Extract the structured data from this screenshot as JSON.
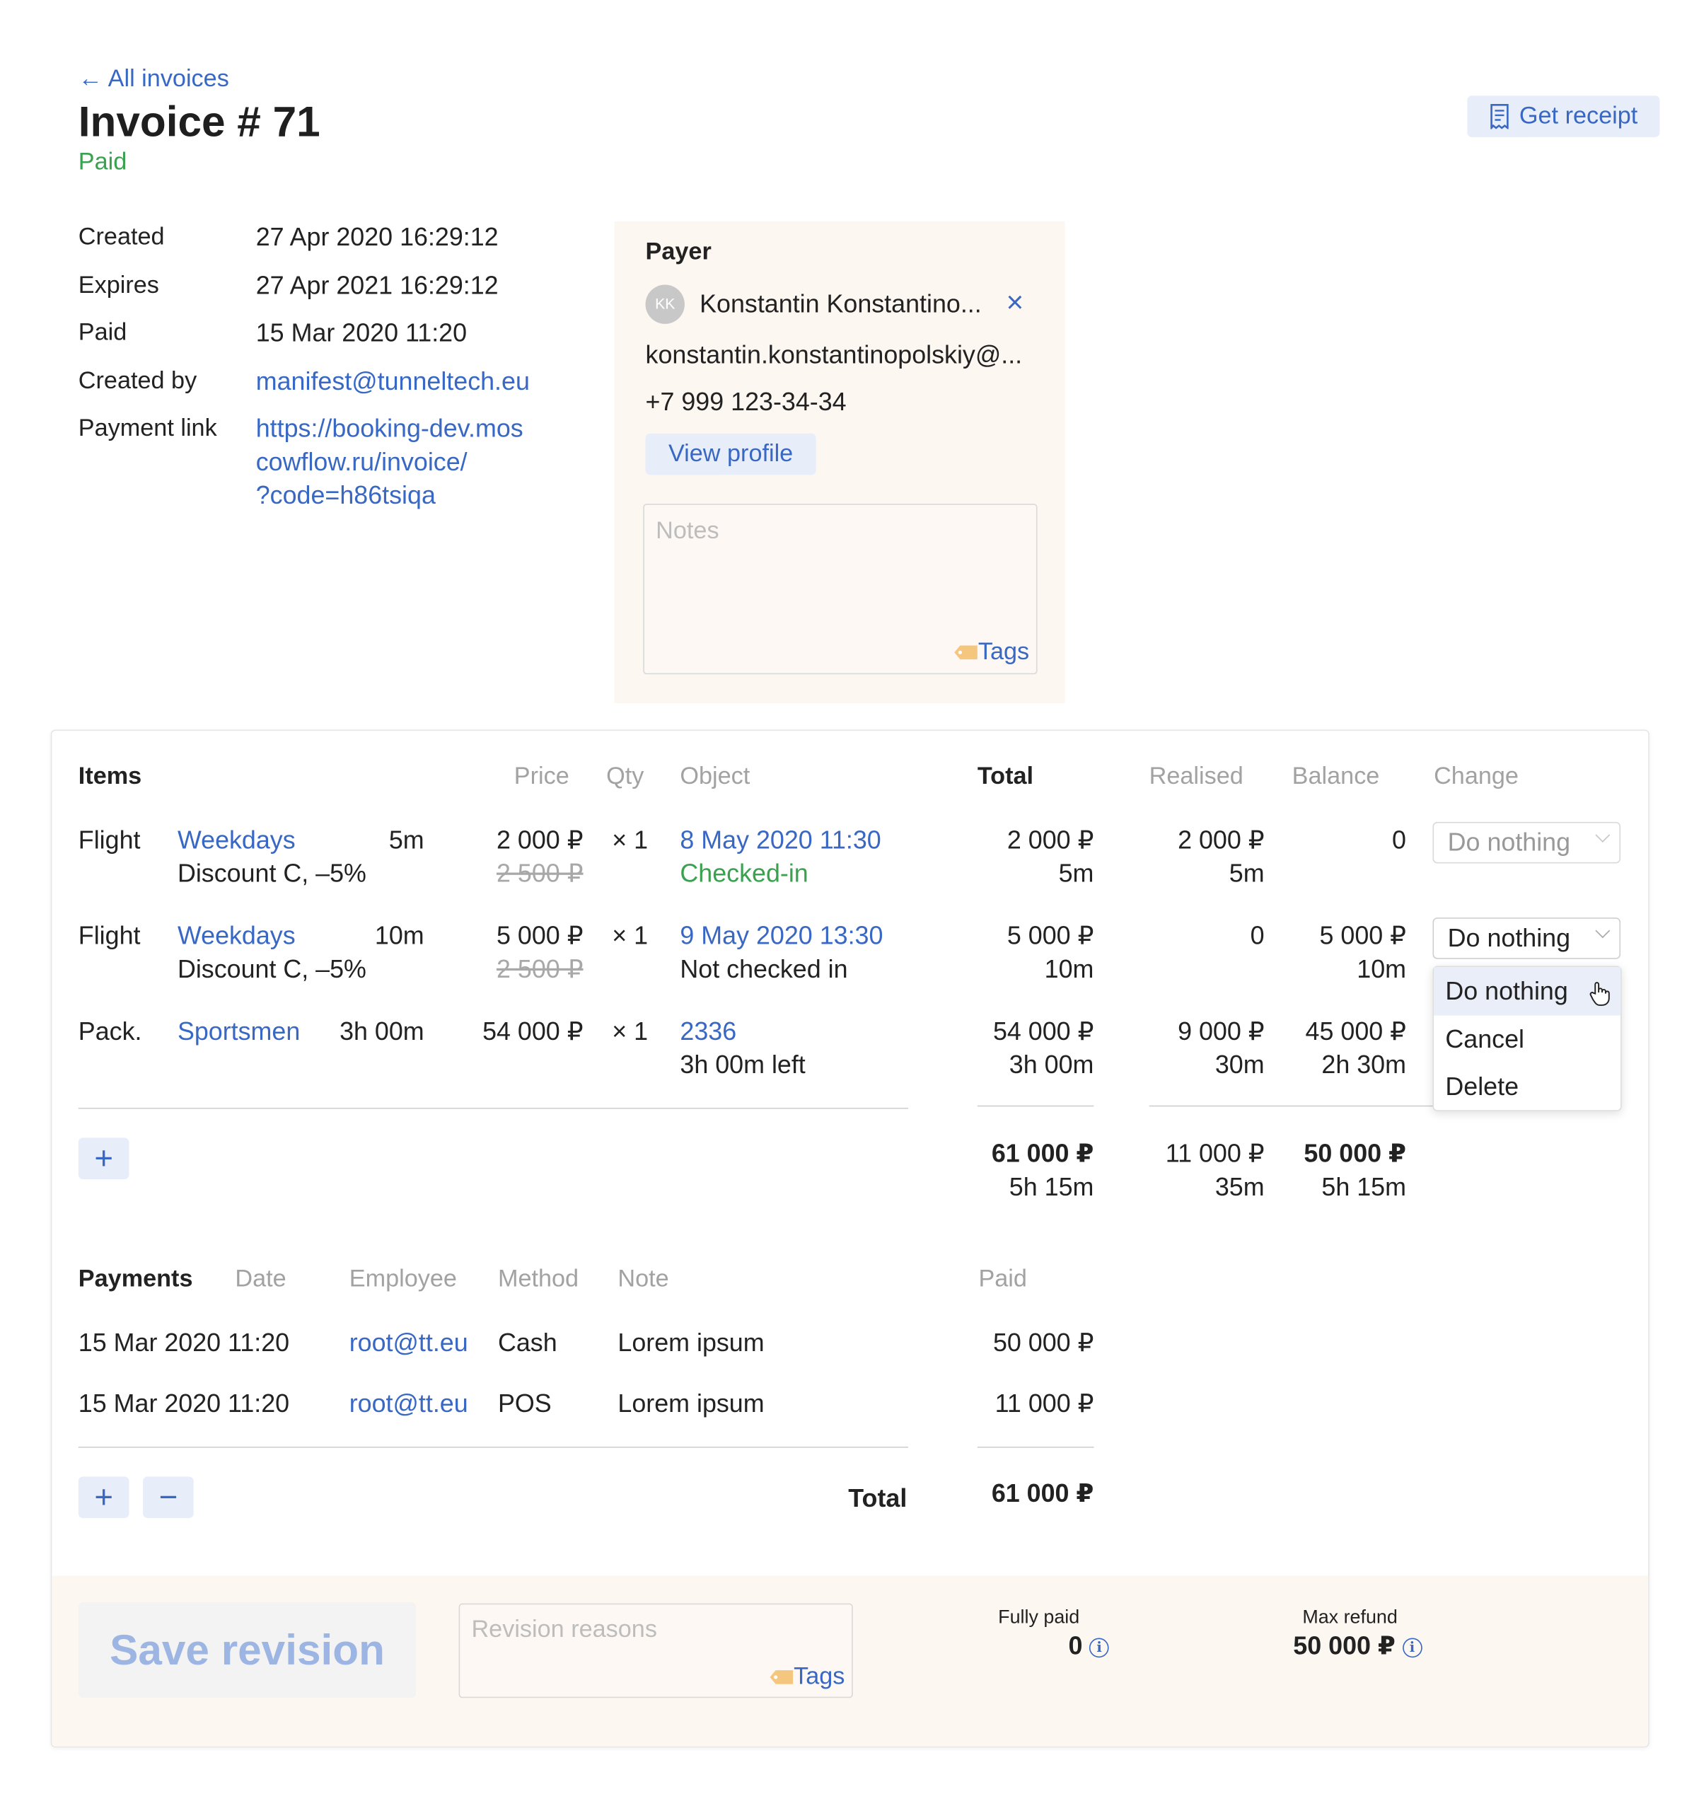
{
  "header": {
    "back_link": "← All invoices",
    "title": "Invoice # 71",
    "status": "Paid",
    "receipt_button": "Get receipt"
  },
  "details": {
    "created_label": "Created",
    "created_value": "27 Apr 2020 16:29:12",
    "expires_label": "Expires",
    "expires_value": "27 Apr 2021 16:29:12",
    "paid_label": "Paid",
    "paid_value": "15 Mar 2020 11:20",
    "created_by_label": "Created by",
    "created_by_value": "manifest@tunneltech.eu",
    "payment_link_label": "Payment link",
    "payment_link_lines": [
      "https://booking-dev.mos",
      "cowflow.ru/invoice/",
      "?code=h86tsiqa"
    ]
  },
  "payer": {
    "heading": "Payer",
    "initials": "KK",
    "name": "Konstantin Konstantino...",
    "remove": "×",
    "email": "konstantin.konstantinopolskiy@...",
    "phone": "+7 999 123-34-34",
    "view_profile": "View profile",
    "notes_placeholder": "Notes",
    "tags": "Tags"
  },
  "items": {
    "headers": {
      "items": "Items",
      "price": "Price",
      "qty": "Qty",
      "object": "Object",
      "total": "Total",
      "realised": "Realised",
      "balance": "Balance",
      "change": "Change"
    },
    "rows": [
      {
        "type": "Flight",
        "name": "Weekdays",
        "duration": "5m",
        "discount": "Discount C, –5%",
        "price": "2 000 ₽",
        "old_price": "2 500 ₽",
        "qty": "× 1",
        "object": "8 May 2020 11:30",
        "object_sub": "Checked-in",
        "total": "2 000 ₽",
        "total_sub": "5m",
        "realised": "2 000 ₽",
        "realised_sub": "5m",
        "balance": "0",
        "balance_sub": "",
        "change": "Do nothing"
      },
      {
        "type": "Flight",
        "name": "Weekdays",
        "duration": "10m",
        "discount": "Discount C, –5%",
        "price": "5 000 ₽",
        "old_price": "2 500 ₽",
        "qty": "× 1",
        "object": "9 May 2020 13:30",
        "object_sub": "Not checked in",
        "total": "5 000 ₽",
        "total_sub": "10m",
        "realised": "0",
        "realised_sub": "",
        "balance": "5 000 ₽",
        "balance_sub": "10m",
        "change": "Do nothing"
      },
      {
        "type": "Pack.",
        "name": "Sportsmen",
        "duration": "3h 00m",
        "discount": "",
        "price": "54 000 ₽",
        "old_price": "",
        "qty": "× 1",
        "object": "2336",
        "object_sub": "3h 00m left",
        "total": "54 000 ₽",
        "total_sub": "3h 00m",
        "realised": "9 000 ₽",
        "realised_sub": "30m",
        "balance": "45 000 ₽",
        "balance_sub": "2h 30m",
        "change": ""
      }
    ],
    "totals": {
      "total": "61 000 ₽",
      "total_sub": "5h 15m",
      "realised": "11 000 ₽",
      "realised_sub": "35m",
      "balance": "50 000 ₽",
      "balance_sub": "5h 15m"
    },
    "add": "+",
    "dropdown_options": [
      "Do nothing",
      "Cancel",
      "Delete"
    ]
  },
  "payments": {
    "headers": {
      "payments": "Payments",
      "date": "Date",
      "employee": "Employee",
      "method": "Method",
      "note": "Note",
      "paid": "Paid"
    },
    "rows": [
      {
        "date": "15 Mar 2020 11:20",
        "employee": "root@tt.eu",
        "method": "Cash",
        "note": "Lorem ipsum",
        "paid": "50 000 ₽"
      },
      {
        "date": "15 Mar 2020 11:20",
        "employee": "root@tt.eu",
        "method": "POS",
        "note": "Lorem ipsum",
        "paid": "11 000 ₽"
      }
    ],
    "add": "+",
    "remove": "−",
    "total_label": "Total",
    "total_value": "61 000 ₽"
  },
  "footer": {
    "save": "Save revision",
    "reasons_placeholder": "Revision reasons",
    "tags": "Tags",
    "fully_paid_label": "Fully paid",
    "fully_paid_value": "0",
    "max_refund_label": "Max refund",
    "max_refund_value": "50 000 ₽",
    "info_glyph": "i"
  },
  "colors": {
    "accent": "#3868c4",
    "success": "#3aa24f",
    "panel_bg": "#fdf7f2"
  }
}
